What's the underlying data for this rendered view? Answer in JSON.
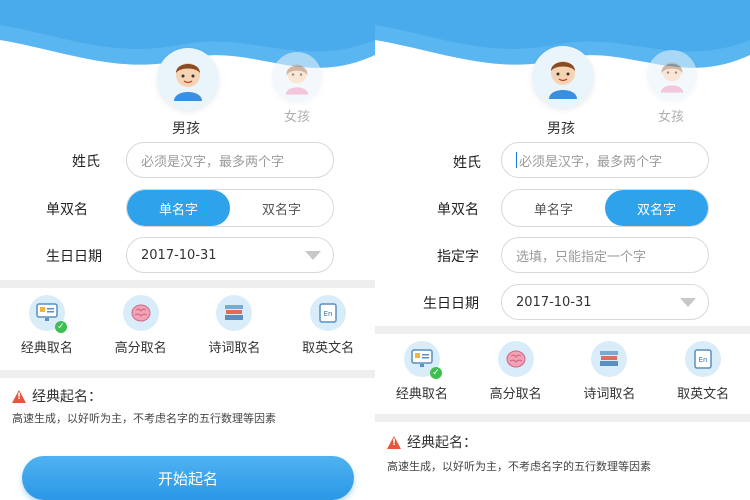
{
  "colors": {
    "accent": "#2fa2ec",
    "wave": "#5ab6f0",
    "warning": "#e8553a",
    "check": "#3fbf4f"
  },
  "left": {
    "gender": {
      "boy": "男孩",
      "girl": "女孩"
    },
    "surname": {
      "label": "姓氏",
      "placeholder": "必须是汉字，最多两个字"
    },
    "name_type": {
      "label": "单双名",
      "options": [
        "单名字",
        "双名字"
      ],
      "selected": "单名字"
    },
    "birthday": {
      "label": "生日日期",
      "value": "2017-10-31"
    },
    "features": [
      "经典取名",
      "高分取名",
      "诗词取名",
      "取英文名"
    ],
    "info": {
      "title": "经典起名：",
      "desc": "高速生成，以好听为主，不考虑名字的五行数理等因素"
    },
    "start_button": "开始起名"
  },
  "right": {
    "gender": {
      "boy": "男孩",
      "girl": "女孩"
    },
    "surname": {
      "label": "姓氏",
      "placeholder": "必须是汉字，最多两个字"
    },
    "name_type": {
      "label": "单双名",
      "options": [
        "单名字",
        "双名字"
      ],
      "selected": "双名字"
    },
    "fixed_char": {
      "label": "指定字",
      "placeholder": "选填，只能指定一个字"
    },
    "birthday": {
      "label": "生日日期",
      "value": "2017-10-31"
    },
    "features": [
      "经典取名",
      "高分取名",
      "诗词取名",
      "取英文名"
    ],
    "info": {
      "title": "经典起名：",
      "desc": "高速生成，以好听为主，不考虑名字的五行数理等因素"
    }
  },
  "icons": [
    "boy-avatar-icon",
    "girl-avatar-icon",
    "dropdown-caret-icon",
    "monitor-icon",
    "brain-icon",
    "books-icon",
    "english-card-icon",
    "check-icon",
    "warning-icon"
  ]
}
